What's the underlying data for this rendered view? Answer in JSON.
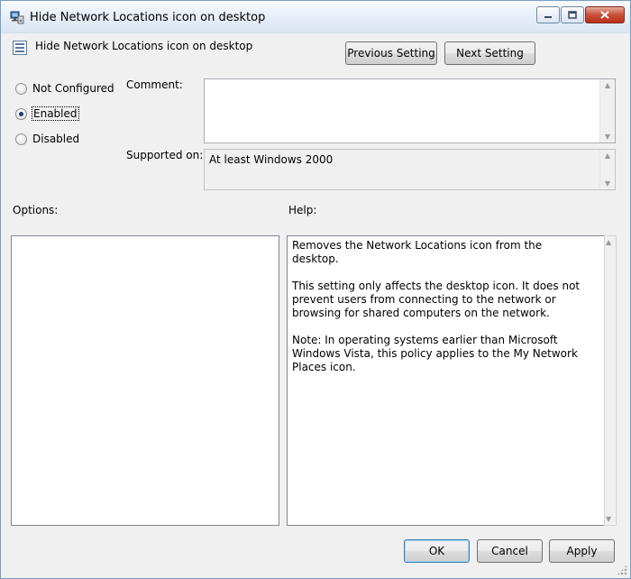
{
  "window": {
    "title": "Hide Network Locations icon on desktop",
    "controls": {
      "minimize": "minimize-icon",
      "maximize": "maximize-icon",
      "close": "close-icon"
    }
  },
  "policy": {
    "name": "Hide Network Locations icon on desktop"
  },
  "nav": {
    "previous_label": "Previous Setting",
    "next_label": "Next Setting"
  },
  "state": {
    "options": [
      {
        "label": "Not Configured",
        "checked": false
      },
      {
        "label": "Enabled",
        "checked": true
      },
      {
        "label": "Disabled",
        "checked": false
      }
    ]
  },
  "comment": {
    "label": "Comment:",
    "value": ""
  },
  "supported": {
    "label": "Supported on:",
    "value": "At least Windows 2000"
  },
  "options_section": {
    "label": "Options:"
  },
  "help_section": {
    "label": "Help:",
    "paragraphs": [
      "Removes the Network Locations icon from the desktop.",
      "This setting only affects the desktop icon. It does not prevent users from connecting to the network or browsing for shared computers on the network.",
      "Note: In operating systems earlier than Microsoft Windows Vista, this policy applies to the My Network Places icon."
    ]
  },
  "footer": {
    "ok_label": "OK",
    "cancel_label": "Cancel",
    "apply_label": "Apply"
  }
}
